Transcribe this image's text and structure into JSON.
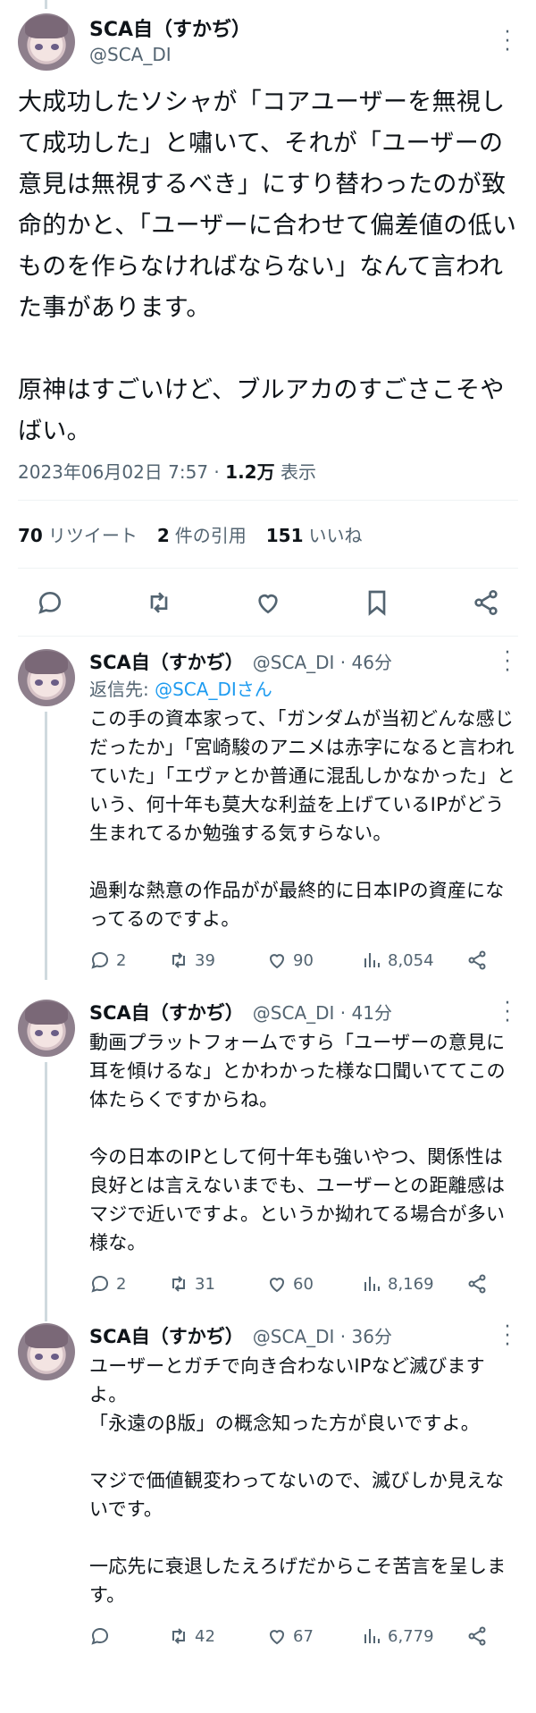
{
  "main": {
    "display_name": "SCA自（すかぢ）",
    "handle": "@SCA_DI",
    "text": "大成功したソシャが「コアユーザーを無視して成功した」と嘯いて、それが「ユーザーの意見は無視するべき」にすり替わったのが致命的かと、「ユーザーに合わせて偏差値の低いものを作らなければならない」なんて言われた事があります。\n\n原神はすごいけど、ブルアカのすごさこそやばい。",
    "timestamp": "2023年06月02日 7:57",
    "views_count": "1.2万",
    "views_label": "表示",
    "retweets_count": "70",
    "retweets_label": "リツイート",
    "quotes_count": "2",
    "quotes_label": "件の引用",
    "likes_count": "151",
    "likes_label": "いいね"
  },
  "replies": [
    {
      "display_name": "SCA自（すかぢ）",
      "handle_time": "@SCA_DI · 46分",
      "reply_to_prefix": "返信先: ",
      "reply_to_handle": "@SCA_DIさん",
      "text": "この手の資本家って、「ガンダムが当初どんな感じだったか」「宮崎駿のアニメは赤字になると言われていた」「エヴァとか普通に混乱しかなかった」という、何十年も莫大な利益を上げているIPがどう生まれてるか勉強する気すらない。\n\n過剰な熱意の作品がが最終的に日本IPの資産になってるのですよ。",
      "comments": "2",
      "retweets": "39",
      "likes": "90",
      "views": "8,054"
    },
    {
      "display_name": "SCA自（すかぢ）",
      "handle_time": "@SCA_DI · 41分",
      "text": "動画プラットフォームですら「ユーザーの意見に耳を傾けるな」とかわかった様な口聞いててこの体たらくですからね。\n\n今の日本のIPとして何十年も強いやつ、関係性は良好とは言えないまでも、ユーザーとの距離感はマジで近いですよ。というか拗れてる場合が多い様な。",
      "comments": "2",
      "retweets": "31",
      "likes": "60",
      "views": "8,169"
    },
    {
      "display_name": "SCA自（すかぢ）",
      "handle_time": "@SCA_DI · 36分",
      "text": "ユーザーとガチで向き合わないIPなど滅びますよ。\n「永遠のβ版」の概念知った方が良いですよ。\n\nマジで価値観変わってないので、滅びしか見えないです。\n\n一応先に衰退したえろげだからこそ苦言を呈します。",
      "comments": "",
      "retweets": "42",
      "likes": "67",
      "views": "6,779"
    }
  ]
}
